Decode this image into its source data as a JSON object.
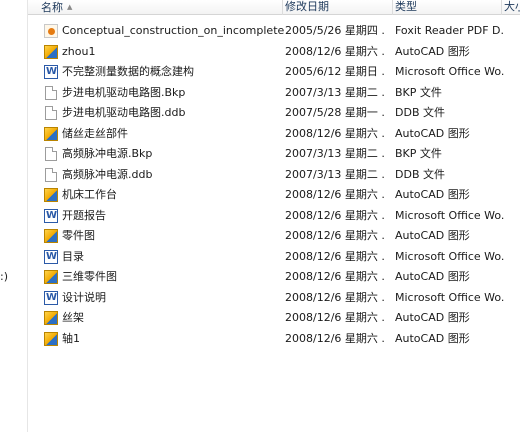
{
  "columns": {
    "name": "名称",
    "date": "修改日期",
    "type": "类型",
    "size": "大小"
  },
  "left_pane": {
    "cut_text": ":)"
  },
  "files": [
    {
      "name": "Conceptual_construction_on_incomplete_sur...",
      "date": "2005/5/26 星期四 ...",
      "type": "Foxit Reader PDF D...",
      "icon": "pdf-file-icon"
    },
    {
      "name": "zhou1",
      "date": "2008/12/6 星期六 ...",
      "type": "AutoCAD 图形",
      "icon": "autocad-file-icon"
    },
    {
      "name": "不完整测量数据的概念建构",
      "date": "2005/6/12 星期日 ...",
      "type": "Microsoft Office Wo...",
      "icon": "word-document-icon"
    },
    {
      "name": "步进电机驱动电路图.Bkp",
      "date": "2007/3/13 星期二 ...",
      "type": "BKP 文件",
      "icon": "generic-file-icon"
    },
    {
      "name": "步进电机驱动电路图.ddb",
      "date": "2007/5/28 星期一 ...",
      "type": "DDB 文件",
      "icon": "generic-file-icon"
    },
    {
      "name": "储丝走丝部件",
      "date": "2008/12/6 星期六 ...",
      "type": "AutoCAD 图形",
      "icon": "autocad-file-icon"
    },
    {
      "name": "高频脉冲电源.Bkp",
      "date": "2007/3/13 星期二 ...",
      "type": "BKP 文件",
      "icon": "generic-file-icon"
    },
    {
      "name": "高频脉冲电源.ddb",
      "date": "2007/3/13 星期二 ...",
      "type": "DDB 文件",
      "icon": "generic-file-icon"
    },
    {
      "name": "机床工作台",
      "date": "2008/12/6 星期六 ...",
      "type": "AutoCAD 图形",
      "icon": "autocad-file-icon"
    },
    {
      "name": "开题报告",
      "date": "2008/12/6 星期六 ...",
      "type": "Microsoft Office Wo...",
      "icon": "word-document-icon"
    },
    {
      "name": "零件图",
      "date": "2008/12/6 星期六 ...",
      "type": "AutoCAD 图形",
      "icon": "autocad-file-icon"
    },
    {
      "name": "目录",
      "date": "2008/12/6 星期六 ...",
      "type": "Microsoft Office Wo...",
      "icon": "word-document-icon"
    },
    {
      "name": "三维零件图",
      "date": "2008/12/6 星期六 ...",
      "type": "AutoCAD 图形",
      "icon": "autocad-file-icon"
    },
    {
      "name": "设计说明",
      "date": "2008/12/6 星期六 ...",
      "type": "Microsoft Office Wo...",
      "icon": "word-document-icon"
    },
    {
      "name": "丝架",
      "date": "2008/12/6 星期六 ...",
      "type": "AutoCAD 图形",
      "icon": "autocad-file-icon"
    },
    {
      "name": "轴1",
      "date": "2008/12/6 星期六 ...",
      "type": "AutoCAD 图形",
      "icon": "autocad-file-icon"
    }
  ]
}
